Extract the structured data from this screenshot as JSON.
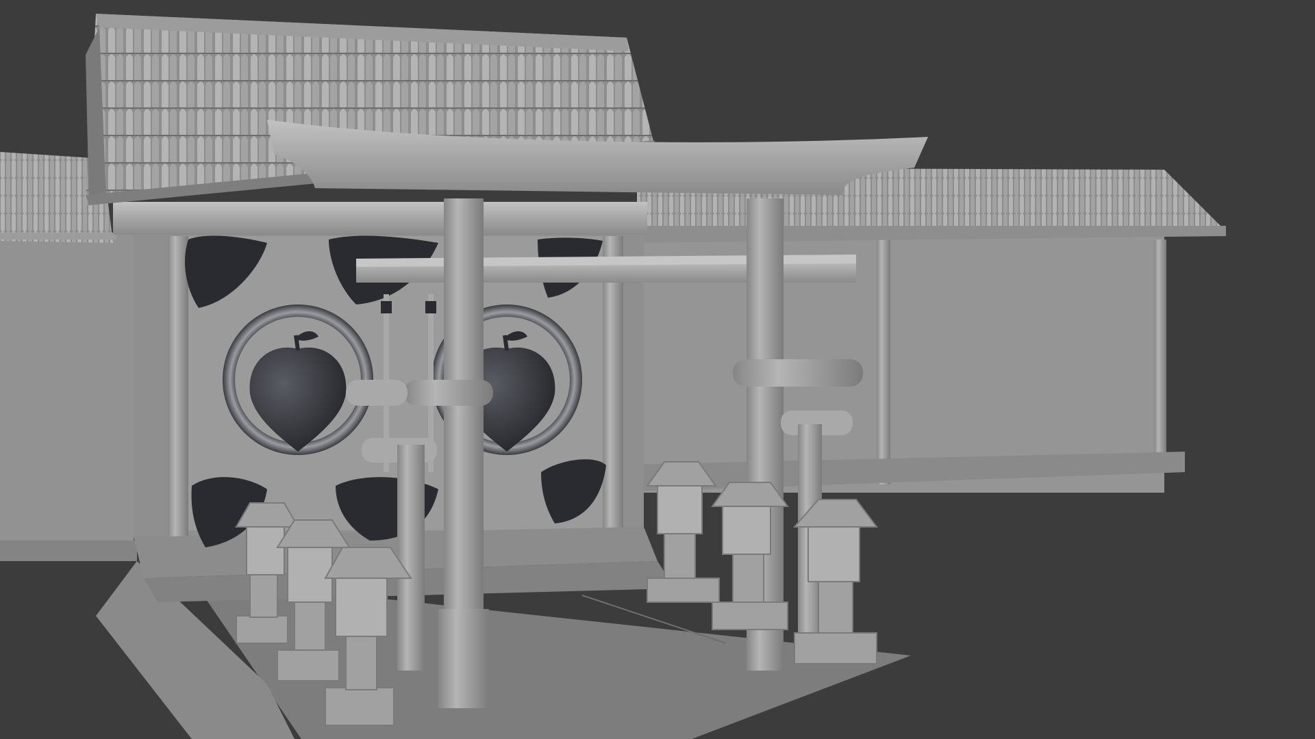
{
  "viewport": {
    "background_color": "#3c3c3c",
    "shading": "solid-clay",
    "surface_color": "#9a9a9a",
    "accent_color": "#2a2b30"
  },
  "scene": {
    "objects": [
      "shrine-building",
      "tiled-roof",
      "perimeter-wall",
      "torii-gate-large",
      "torii-gate-small",
      "stone-lanterns",
      "peach-crest-emblems",
      "leaf-ornaments",
      "stone-steps",
      "stone-floor"
    ]
  }
}
